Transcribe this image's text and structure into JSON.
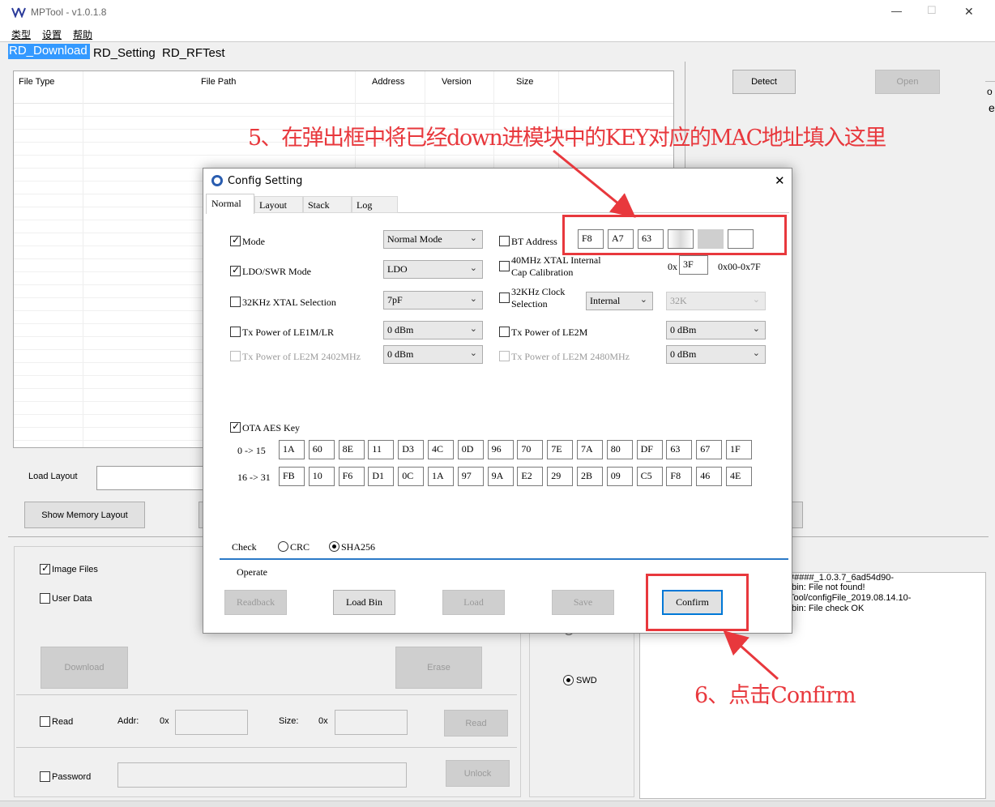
{
  "window": {
    "title": "MPTool - v1.0.1.8",
    "controls": {
      "minimize": "—",
      "maximize": "☐",
      "close": "✕"
    }
  },
  "menu": [
    "类型",
    "设置",
    "帮助"
  ],
  "tabs": [
    "RD_Download",
    "RD_Setting",
    "RD_RFTest"
  ],
  "table": {
    "headers": [
      "File Type",
      "File Path",
      "Address",
      "Version",
      "Size"
    ]
  },
  "main": {
    "detect": "Detect",
    "open": "Open",
    "load_layout_label": "Load Layout",
    "show_memory_layout": "Show Memory Layout",
    "image_files": "Image Files",
    "user_data": "User Data",
    "download": "Download",
    "erase": "Erase",
    "read_label": "Read",
    "addr_label": "Addr:",
    "size_label": "Size:",
    "hex_prefix": "0x",
    "read_button": "Read",
    "password_label": "Password",
    "unlock_button": "Unlock",
    "swd": "SWD",
    "log_lines": [
      "#####_1.0.3.7_6ad54d90-",
      ".bin: File not found!",
      "Tool/configFile_2019.08.14.10-",
      ".bin: File check OK"
    ],
    "side_fragments": [
      "o",
      "e"
    ]
  },
  "dialog": {
    "title": "Config Setting",
    "close": "✕",
    "tabs": [
      "Normal",
      "Layout",
      "Stack",
      "Log"
    ],
    "mode": {
      "label": "Mode",
      "value": "Normal Mode"
    },
    "ldo": {
      "label": "LDO/SWR Mode",
      "value": "LDO"
    },
    "xtal32": {
      "label": "32KHz XTAL Selection",
      "value": "7pF"
    },
    "txle1m": {
      "label": "Tx Power of LE1M/LR",
      "value": "0 dBm"
    },
    "txle2m2402": {
      "label": "Tx Power of LE2M 2402MHz",
      "value": "0 dBm"
    },
    "bt_address": {
      "label": "BT Address",
      "bytes": [
        "F8",
        "A7",
        "63",
        "",
        "",
        ""
      ]
    },
    "xtal40": {
      "label1": "40MHz XTAL Internal",
      "label2": "Cap Calibration",
      "prefix": "0x",
      "value": "3F",
      "range": "0x00-0x7F"
    },
    "clock32": {
      "label1": "32KHz Clock",
      "label2": "Selection",
      "source": "Internal",
      "freq": "32K"
    },
    "txle2m": {
      "label": "Tx Power of LE2M",
      "value": "0 dBm"
    },
    "txle2m2480": {
      "label": "Tx Power of LE2M 2480MHz",
      "value": "0 dBm"
    },
    "ota": {
      "label": "OTA AES Key",
      "row1_label": "0 -> 15",
      "row2_label": "16 -> 31",
      "row1": [
        "1A",
        "60",
        "8E",
        "11",
        "D3",
        "4C",
        "0D",
        "96",
        "70",
        "7E",
        "7A",
        "80",
        "DF",
        "63",
        "67",
        "1F"
      ],
      "row2": [
        "FB",
        "10",
        "F6",
        "D1",
        "0C",
        "1A",
        "97",
        "9A",
        "E2",
        "29",
        "2B",
        "09",
        "C5",
        "F8",
        "46",
        "4E"
      ]
    },
    "check": {
      "label": "Check",
      "crc": "CRC",
      "sha": "SHA256"
    },
    "operate_label": "Operate",
    "buttons": {
      "readback": "Readback",
      "load_bin": "Load Bin",
      "load": "Load",
      "save": "Save",
      "confirm": "Confirm"
    }
  },
  "annotations": {
    "step5": "5、在弹出框中将已经down进模块中的KEY对应的MAC地址填入这里",
    "step6": "6、点击Confirm",
    "color": "#e8383d"
  }
}
